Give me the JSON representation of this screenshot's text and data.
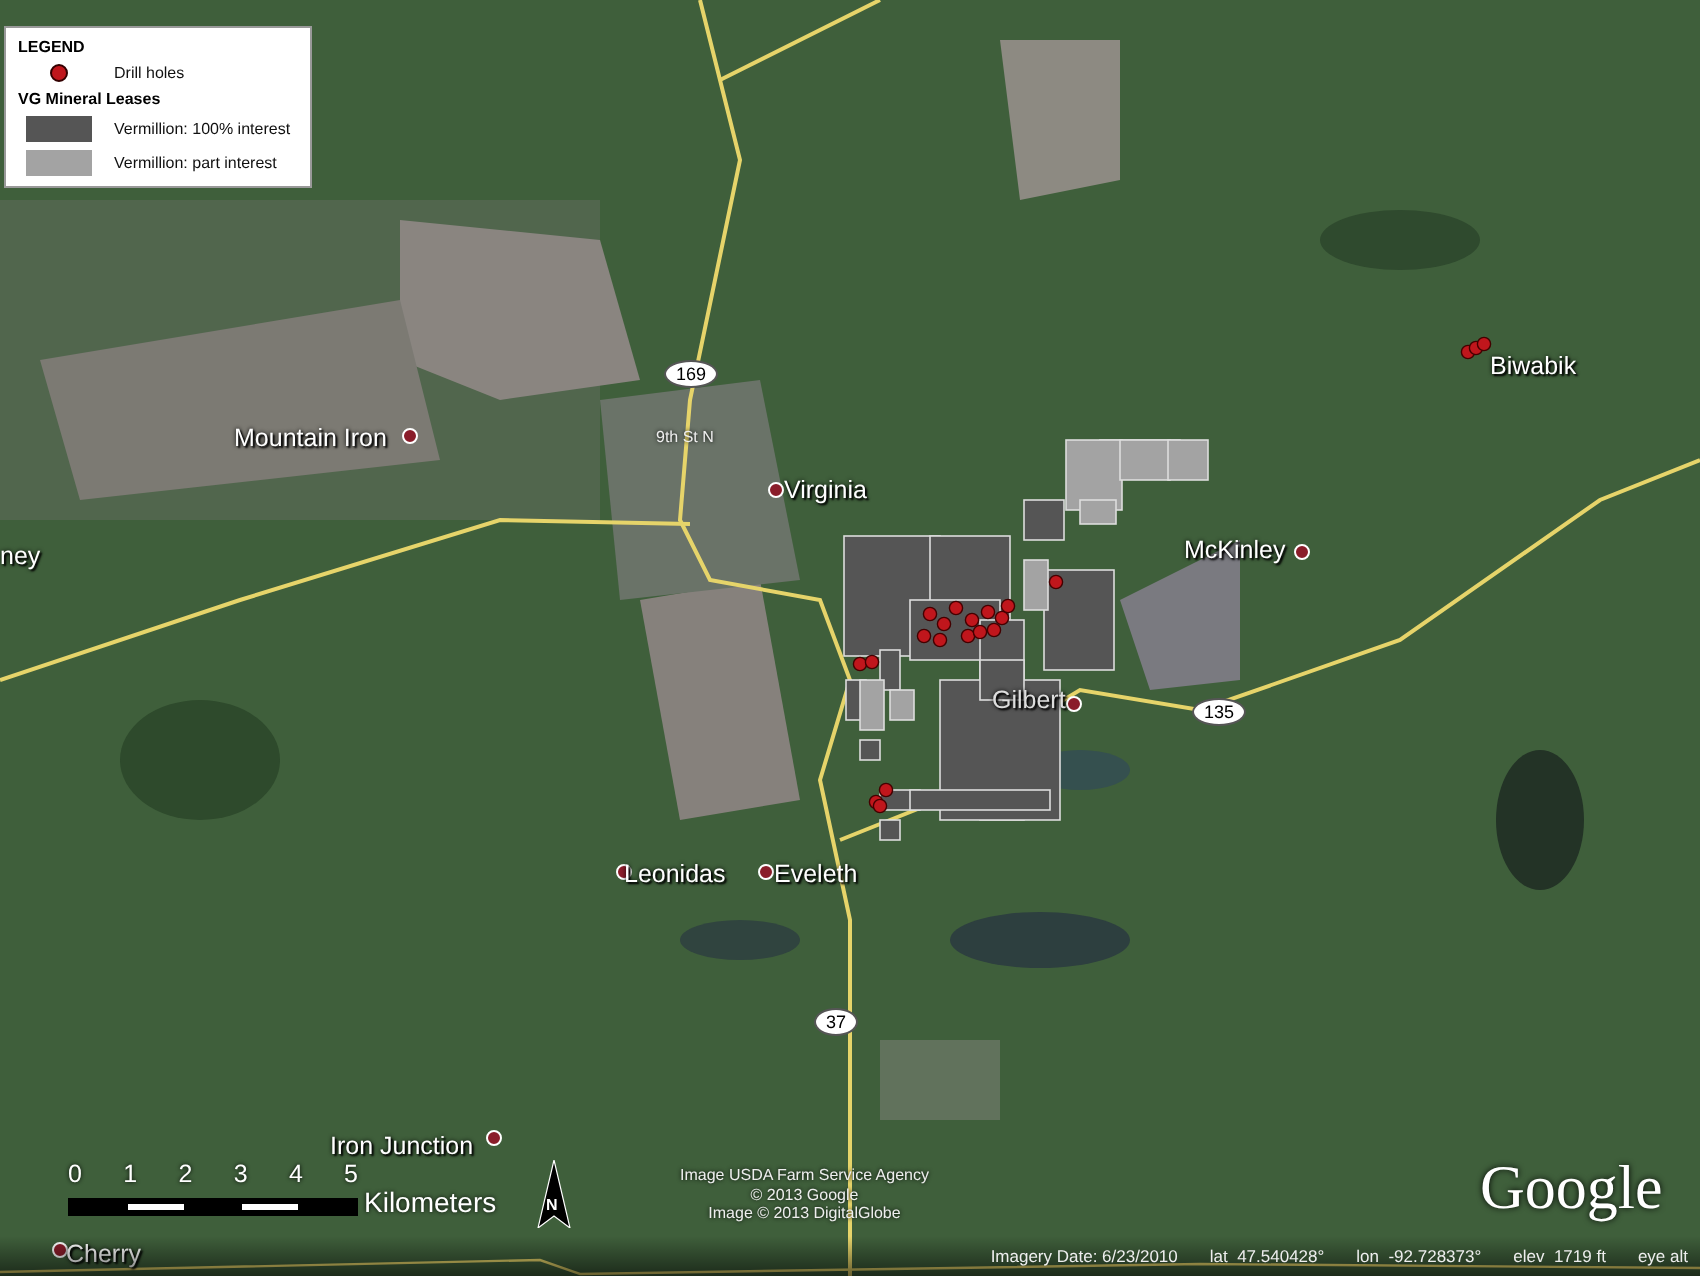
{
  "legend": {
    "title": "LEGEND",
    "items": [
      {
        "kind": "dot",
        "label": "Drill holes",
        "color": "#c0161c"
      },
      {
        "kind": "heading",
        "label": "VG Mineral Leases"
      },
      {
        "kind": "swatch",
        "label": "Vermillion: 100% interest",
        "color": "#555555"
      },
      {
        "kind": "swatch",
        "label": "Vermillion: part interest",
        "color": "#a3a3a3"
      }
    ]
  },
  "places": [
    "Mountain Iron",
    "Virginia",
    "McKinley",
    "Biwabik",
    "ney",
    "Gilbert",
    "Leonidas",
    "Eveleth",
    "Iron Junction",
    "Cherry"
  ],
  "street_labels": [
    "9th St N"
  ],
  "road_shields": [
    "169",
    "135",
    "37"
  ],
  "scale_bar": {
    "ticks": [
      "0",
      "1",
      "2",
      "3",
      "4",
      "5"
    ],
    "unit": "Kilometers"
  },
  "north_arrow": {
    "label": "N"
  },
  "attribution": [
    "Image USDA Farm Service Agency",
    "© 2013 Google",
    "Image © 2013 DigitalGlobe"
  ],
  "logo": "Google",
  "status_bar": [
    "Imagery Date: 6/23/2010",
    "lat  47.540428°",
    "lon  -92.728373°",
    "elev  1719 ft",
    "eye alt"
  ]
}
